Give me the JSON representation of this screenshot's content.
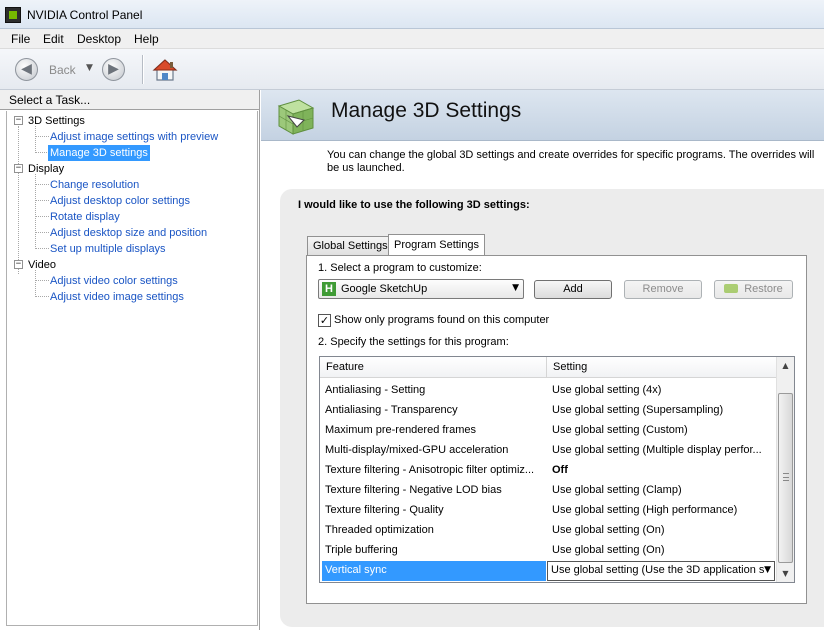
{
  "window": {
    "title": "NVIDIA Control Panel"
  },
  "menu": [
    "File",
    "Edit",
    "Desktop",
    "Help"
  ],
  "toolbar": {
    "back_label": "Back"
  },
  "left": {
    "header": "Select a Task...",
    "tree": [
      {
        "label": "3D Settings",
        "toggle": "−",
        "children": [
          {
            "label": "Adjust image settings with preview"
          },
          {
            "label": "Manage 3D settings",
            "selected": true
          }
        ]
      },
      {
        "label": "Display",
        "toggle": "−",
        "children": [
          {
            "label": "Change resolution"
          },
          {
            "label": "Adjust desktop color settings"
          },
          {
            "label": "Rotate display"
          },
          {
            "label": "Adjust desktop size and position"
          },
          {
            "label": "Set up multiple displays"
          }
        ]
      },
      {
        "label": "Video",
        "toggle": "−",
        "children": [
          {
            "label": "Adjust video color settings"
          },
          {
            "label": "Adjust video image settings"
          }
        ]
      }
    ]
  },
  "main": {
    "title": "Manage 3D Settings",
    "description": "You can change the global 3D settings and create overrides for specific programs. The overrides will be us launched.",
    "panel_heading": "I would like to use the following 3D settings:",
    "tabs": [
      "Global Settings",
      "Program Settings"
    ],
    "active_tab": "Program Settings",
    "step1": "1. Select a program to customize:",
    "program": {
      "name": "Google SketchUp",
      "icon": "H"
    },
    "buttons": {
      "add": "Add",
      "remove": "Remove",
      "restore": "Restore"
    },
    "checkbox": {
      "label": "Show only programs found on this computer",
      "checked": true
    },
    "step2": "2. Specify the settings for this program:",
    "columns": [
      "Feature",
      "Setting"
    ],
    "rows": [
      {
        "feature": "Antialiasing - Setting",
        "setting": "Use global setting (4x)"
      },
      {
        "feature": "Antialiasing - Transparency",
        "setting": "Use global setting (Supersampling)"
      },
      {
        "feature": "Maximum pre-rendered frames",
        "setting": "Use global setting (Custom)"
      },
      {
        "feature": "Multi-display/mixed-GPU acceleration",
        "setting": "Use global setting (Multiple display perfor..."
      },
      {
        "feature": "Texture filtering - Anisotropic filter optimiz...",
        "setting": "Off",
        "bold": true
      },
      {
        "feature": "Texture filtering - Negative LOD bias",
        "setting": "Use global setting (Clamp)"
      },
      {
        "feature": "Texture filtering - Quality",
        "setting": "Use global setting (High performance)"
      },
      {
        "feature": "Threaded optimization",
        "setting": "Use global setting (On)"
      },
      {
        "feature": "Triple buffering",
        "setting": "Use global setting (On)"
      },
      {
        "feature": "Vertical sync",
        "setting": "Use global setting (Use the 3D application s",
        "selected": true
      }
    ]
  },
  "icons": {
    "back": "left-arrow-circle-icon",
    "forward": "right-arrow-circle-icon",
    "home": "home-icon",
    "banner": "3d-cube-icon"
  },
  "colors": {
    "selection": "#3399ff",
    "link": "#1a55c4",
    "nvidia_green": "#76b900"
  }
}
